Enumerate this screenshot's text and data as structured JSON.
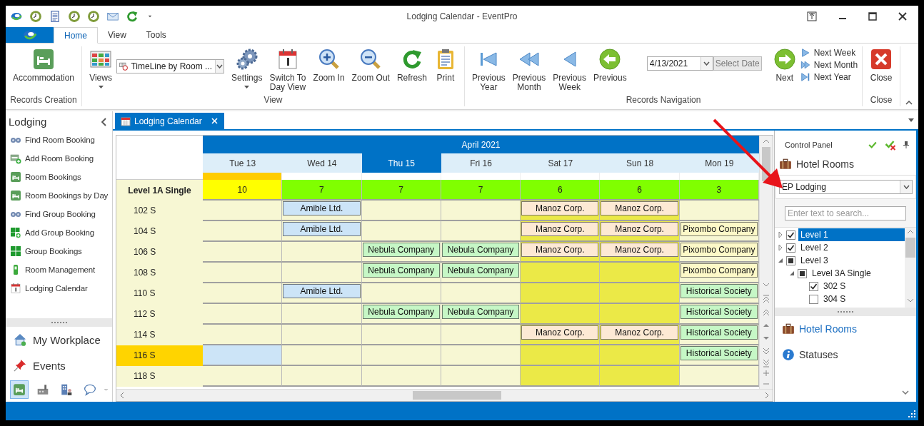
{
  "window": {
    "title": "Lodging Calendar - EventPro"
  },
  "ribbon_tabs": [
    {
      "label": "Home",
      "selected": true
    },
    {
      "label": "View",
      "selected": false
    },
    {
      "label": "Tools",
      "selected": false
    }
  ],
  "ribbon_groups": [
    {
      "label": "Records Creation",
      "items": [
        {
          "kind": "large",
          "label": "Accommodation",
          "dropdown": false
        }
      ]
    },
    {
      "label": "View",
      "items": [
        {
          "kind": "large",
          "label": "Views",
          "dropdown": true
        },
        {
          "kind": "combo",
          "value": "TimeLine by Room ..."
        },
        {
          "kind": "large",
          "label": "Settings",
          "dropdown": true
        },
        {
          "kind": "large",
          "label": "Switch To\nDay View",
          "dropdown": false
        },
        {
          "kind": "large",
          "label": "Zoom In",
          "dropdown": false
        },
        {
          "kind": "large",
          "label": "Zoom Out",
          "dropdown": false
        },
        {
          "kind": "large",
          "label": "Refresh",
          "dropdown": false
        },
        {
          "kind": "large",
          "label": "Print",
          "dropdown": false
        }
      ]
    },
    {
      "label": "Records Navigation",
      "items": [
        {
          "kind": "large",
          "label": "Previous\nYear",
          "dropdown": false
        },
        {
          "kind": "large",
          "label": "Previous\nMonth",
          "dropdown": false
        },
        {
          "kind": "large",
          "label": "Previous\nWeek",
          "dropdown": false
        },
        {
          "kind": "large",
          "label": "Previous",
          "dropdown": false
        },
        {
          "kind": "date",
          "value": "4/13/2021",
          "button": "Select Date"
        },
        {
          "kind": "large",
          "label": "Next",
          "dropdown": false
        },
        {
          "kind": "stack",
          "items": [
            "Next Week",
            "Next Month",
            "Next Year"
          ]
        }
      ]
    },
    {
      "label": "Close",
      "items": [
        {
          "kind": "large",
          "label": "Close",
          "dropdown": false
        }
      ]
    }
  ],
  "sidebar": {
    "title": "Lodging",
    "items": [
      "Find Room Booking",
      "Add Room Booking",
      "Room Bookings",
      "Room Bookings by Day",
      "Find Group Booking",
      "Add Group Booking",
      "Group Bookings",
      "Room Management",
      "Lodging Calendar"
    ],
    "sections": [
      "My Workplace",
      "Events"
    ],
    "bottom_buttons": [
      {
        "selected": true
      },
      {
        "selected": false
      },
      {
        "selected": false
      },
      {
        "selected": false
      }
    ]
  },
  "doc_tabs": [
    {
      "label": "Lodging Calendar",
      "selected": true
    }
  ],
  "calendar": {
    "month": "April 2021",
    "days": [
      {
        "label": "Tue 13",
        "selected": false,
        "today": true,
        "weekend": false
      },
      {
        "label": "Wed 14",
        "selected": false,
        "today": false,
        "weekend": false
      },
      {
        "label": "Thu 15",
        "selected": true,
        "today": false,
        "weekend": false
      },
      {
        "label": "Fri 16",
        "selected": false,
        "today": false,
        "weekend": false
      },
      {
        "label": "Sat 17",
        "selected": false,
        "today": false,
        "weekend": true
      },
      {
        "label": "Sun 18",
        "selected": false,
        "today": false,
        "weekend": true
      },
      {
        "label": "Mon 19",
        "selected": false,
        "today": false,
        "weekend": false
      }
    ],
    "group": {
      "label": "Level 1A Single",
      "counts": [
        {
          "text": "10",
          "color": "#ffff00"
        },
        {
          "text": "7",
          "color": "#80ff00"
        },
        {
          "text": "7",
          "color": "#80ff00"
        },
        {
          "text": "7",
          "color": "#80ff00"
        },
        {
          "text": "6",
          "color": "#80ff00"
        },
        {
          "text": "6",
          "color": "#80ff00"
        },
        {
          "text": "3",
          "color": "#80ff00"
        }
      ]
    },
    "rooms": [
      {
        "name": "102 S",
        "selected": false,
        "cells": [
          {
            "selected": false
          },
          {
            "selected": false,
            "text": "Amible Ltd.",
            "color": "#cce4f7"
          },
          {
            "selected": false
          },
          {
            "selected": false
          },
          {
            "selected": false,
            "text": "Manoz Corp.",
            "color": "#fde9d4"
          },
          {
            "selected": false,
            "text": "Manoz Corp.",
            "color": "#fde9d4"
          },
          {
            "selected": false
          }
        ]
      },
      {
        "name": "104 S",
        "selected": false,
        "cells": [
          {
            "selected": false
          },
          {
            "selected": false,
            "text": "Amible Ltd.",
            "color": "#cce4f7"
          },
          {
            "selected": false
          },
          {
            "selected": false
          },
          {
            "selected": false,
            "text": "Manoz Corp.",
            "color": "#fde9d4"
          },
          {
            "selected": false,
            "text": "Manoz Corp.",
            "color": "#fde9d4"
          },
          {
            "selected": false,
            "text": "Pixombo Company",
            "color": "#fdf9c8"
          }
        ]
      },
      {
        "name": "106 S",
        "selected": false,
        "cells": [
          {
            "selected": false
          },
          {
            "selected": false
          },
          {
            "selected": false,
            "text": "Nebula Company",
            "color": "#c6f7c6"
          },
          {
            "selected": false,
            "text": "Nebula Company",
            "color": "#c6f7c6"
          },
          {
            "selected": false,
            "text": "Manoz Corp.",
            "color": "#fde9d4"
          },
          {
            "selected": false,
            "text": "Manoz Corp.",
            "color": "#fde9d4"
          },
          {
            "selected": false,
            "text": "Pixombo Company",
            "color": "#fdf9c8"
          }
        ]
      },
      {
        "name": "108 S",
        "selected": false,
        "cells": [
          {
            "selected": false
          },
          {
            "selected": false
          },
          {
            "selected": false,
            "text": "Nebula Company",
            "color": "#c6f7c6"
          },
          {
            "selected": false,
            "text": "Nebula Company",
            "color": "#c6f7c6"
          },
          {
            "selected": false
          },
          {
            "selected": false
          },
          {
            "selected": false,
            "text": "Pixombo Company",
            "color": "#fdf9c8"
          }
        ]
      },
      {
        "name": "110 S",
        "selected": false,
        "cells": [
          {
            "selected": false
          },
          {
            "selected": false,
            "text": "Amible Ltd.",
            "color": "#cce4f7"
          },
          {
            "selected": false
          },
          {
            "selected": false
          },
          {
            "selected": false
          },
          {
            "selected": false
          },
          {
            "selected": false,
            "text": "Historical Society",
            "color": "#c6f7c6"
          }
        ]
      },
      {
        "name": "112 S",
        "selected": false,
        "cells": [
          {
            "selected": false
          },
          {
            "selected": false
          },
          {
            "selected": false,
            "text": "Nebula Company",
            "color": "#c6f7c6"
          },
          {
            "selected": false,
            "text": "Nebula Company",
            "color": "#c6f7c6"
          },
          {
            "selected": false
          },
          {
            "selected": false
          },
          {
            "selected": false,
            "text": "Historical Society",
            "color": "#c6f7c6"
          }
        ]
      },
      {
        "name": "114 S",
        "selected": false,
        "cells": [
          {
            "selected": false
          },
          {
            "selected": false
          },
          {
            "selected": false
          },
          {
            "selected": false
          },
          {
            "selected": false,
            "text": "Manoz Corp.",
            "color": "#fde9d4"
          },
          {
            "selected": false,
            "text": "Manoz Corp.",
            "color": "#fde9d4"
          },
          {
            "selected": false,
            "text": "Historical Society",
            "color": "#c6f7c6"
          }
        ]
      },
      {
        "name": "116 S",
        "selected": true,
        "cells": [
          {
            "selected": true
          },
          {
            "selected": false
          },
          {
            "selected": false
          },
          {
            "selected": false
          },
          {
            "selected": false
          },
          {
            "selected": false
          },
          {
            "selected": false,
            "text": "Historical Society",
            "color": "#c6f7c6"
          }
        ]
      },
      {
        "name": "118 S",
        "selected": false,
        "cells": [
          {
            "selected": false
          },
          {
            "selected": false
          },
          {
            "selected": false
          },
          {
            "selected": false
          },
          {
            "selected": false
          },
          {
            "selected": false
          },
          {
            "selected": false
          }
        ]
      }
    ]
  },
  "control_panel": {
    "title": "Control Panel",
    "heading": "Hotel Rooms",
    "dropdown": "EP Lodging",
    "search": {
      "placeholder": "Enter text to search..."
    },
    "tree": [
      {
        "label": "Level 1",
        "checked": true,
        "partial": false,
        "selected": true,
        "expanded": false
      },
      {
        "label": "Level 2",
        "checked": true,
        "partial": false,
        "selected": false,
        "expanded": false
      },
      {
        "label": "Level 3",
        "checked": false,
        "partial": true,
        "selected": false,
        "expanded": true,
        "children": [
          {
            "label": "Level 3A Single",
            "checked": false,
            "partial": true,
            "selected": false,
            "expanded": true,
            "children": [
              {
                "label": "302 S",
                "checked": true,
                "partial": false,
                "selected": false
              },
              {
                "label": "304 S",
                "checked": false,
                "partial": false,
                "selected": false
              }
            ]
          }
        ]
      }
    ],
    "nav": [
      {
        "label": "Hotel Rooms",
        "selected": true
      },
      {
        "label": "Statuses",
        "selected": false
      }
    ]
  }
}
